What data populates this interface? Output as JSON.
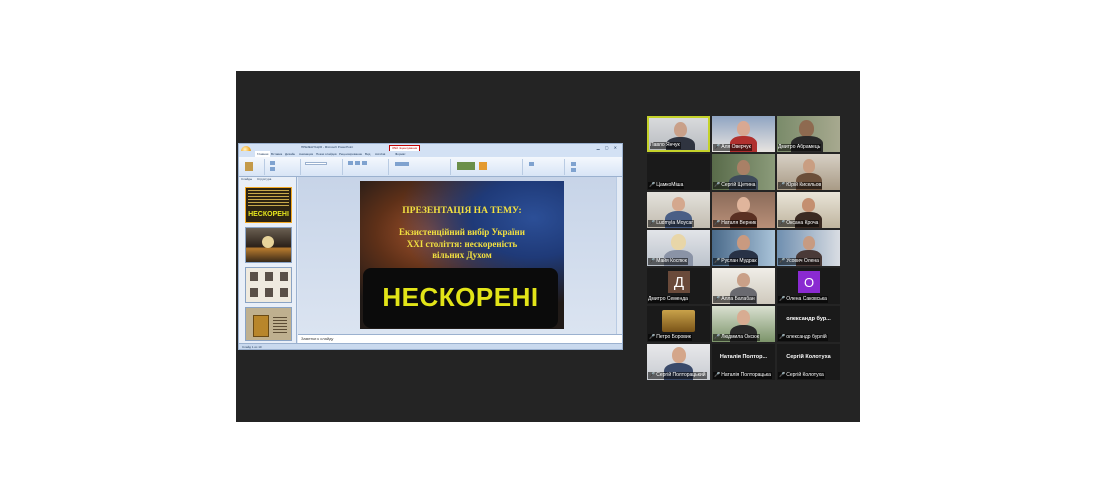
{
  "presentation": {
    "window_title": "ПРЕЗЕНТАЦІЯ - Microsoft PowerPoint",
    "warning": "Збій ліцензування",
    "tabs": [
      "Главная",
      "Вставка",
      "Дизайн",
      "Анимация",
      "Показ слайдов",
      "Рецензирование",
      "Вид",
      "Acrobat",
      "Формат"
    ],
    "left_tabs": [
      "Слайды",
      "Структура"
    ],
    "thumb_title": "НЕСКОРЕНІ",
    "notes_placeholder": "Заметки к слайду",
    "status": "Слайд 1 из 10",
    "slide": {
      "heading": "ПРЕЗЕНТАЦІЯ НА ТЕМУ:",
      "line1": "Екзистенційний вибір України",
      "line2": "XXI століття: нескореність",
      "line3": "вільних Духом",
      "banner": "НЕСКОРЕНІ"
    }
  },
  "participants": [
    {
      "name": "Павло Янчук",
      "mic_muted": false,
      "speaking": true
    },
    {
      "name": "Аля Оверчук",
      "mic_muted": true
    },
    {
      "name": "Дмитро Абрамець",
      "mic_muted": false
    },
    {
      "name": "ЦамкоМіша",
      "mic_muted": true
    },
    {
      "name": "Сергій Щетина",
      "mic_muted": true
    },
    {
      "name": "Юрій Кисельов",
      "mic_muted": true
    },
    {
      "name": "Ludmyla Moyсar",
      "mic_muted": true
    },
    {
      "name": "Наталя Верник",
      "mic_muted": true
    },
    {
      "name": "Оксана Кроча",
      "mic_muted": true
    },
    {
      "name": "Майя Коспюк",
      "mic_muted": true
    },
    {
      "name": "Руслан Мудрак",
      "mic_muted": true
    },
    {
      "name": "Усович Олена",
      "mic_muted": true
    },
    {
      "name": "Дмитро Семенда",
      "mic_muted": false,
      "avatar_letter": "Д",
      "avatar_color": "#6a4a3a"
    },
    {
      "name": "Алла Балабан",
      "mic_muted": true
    },
    {
      "name": "Олена Саковська",
      "mic_muted": true,
      "avatar_letter": "О",
      "avatar_color": "#8a2ad1"
    },
    {
      "name": "Петро Боровик",
      "mic_muted": true
    },
    {
      "name": "Людмила Оксюк",
      "mic_muted": true
    },
    {
      "name": "олександр бурлій",
      "mic_muted": true,
      "big_name": "олександр бур..."
    },
    {
      "name": "Сергій Полторацький",
      "mic_muted": true
    },
    {
      "name": "Наталія Полторацька",
      "mic_muted": true,
      "big_name": "Наталія Полтор..."
    },
    {
      "name": "Сергій Колотуха",
      "mic_muted": true,
      "big_name": "Сергій Колотуха"
    }
  ]
}
